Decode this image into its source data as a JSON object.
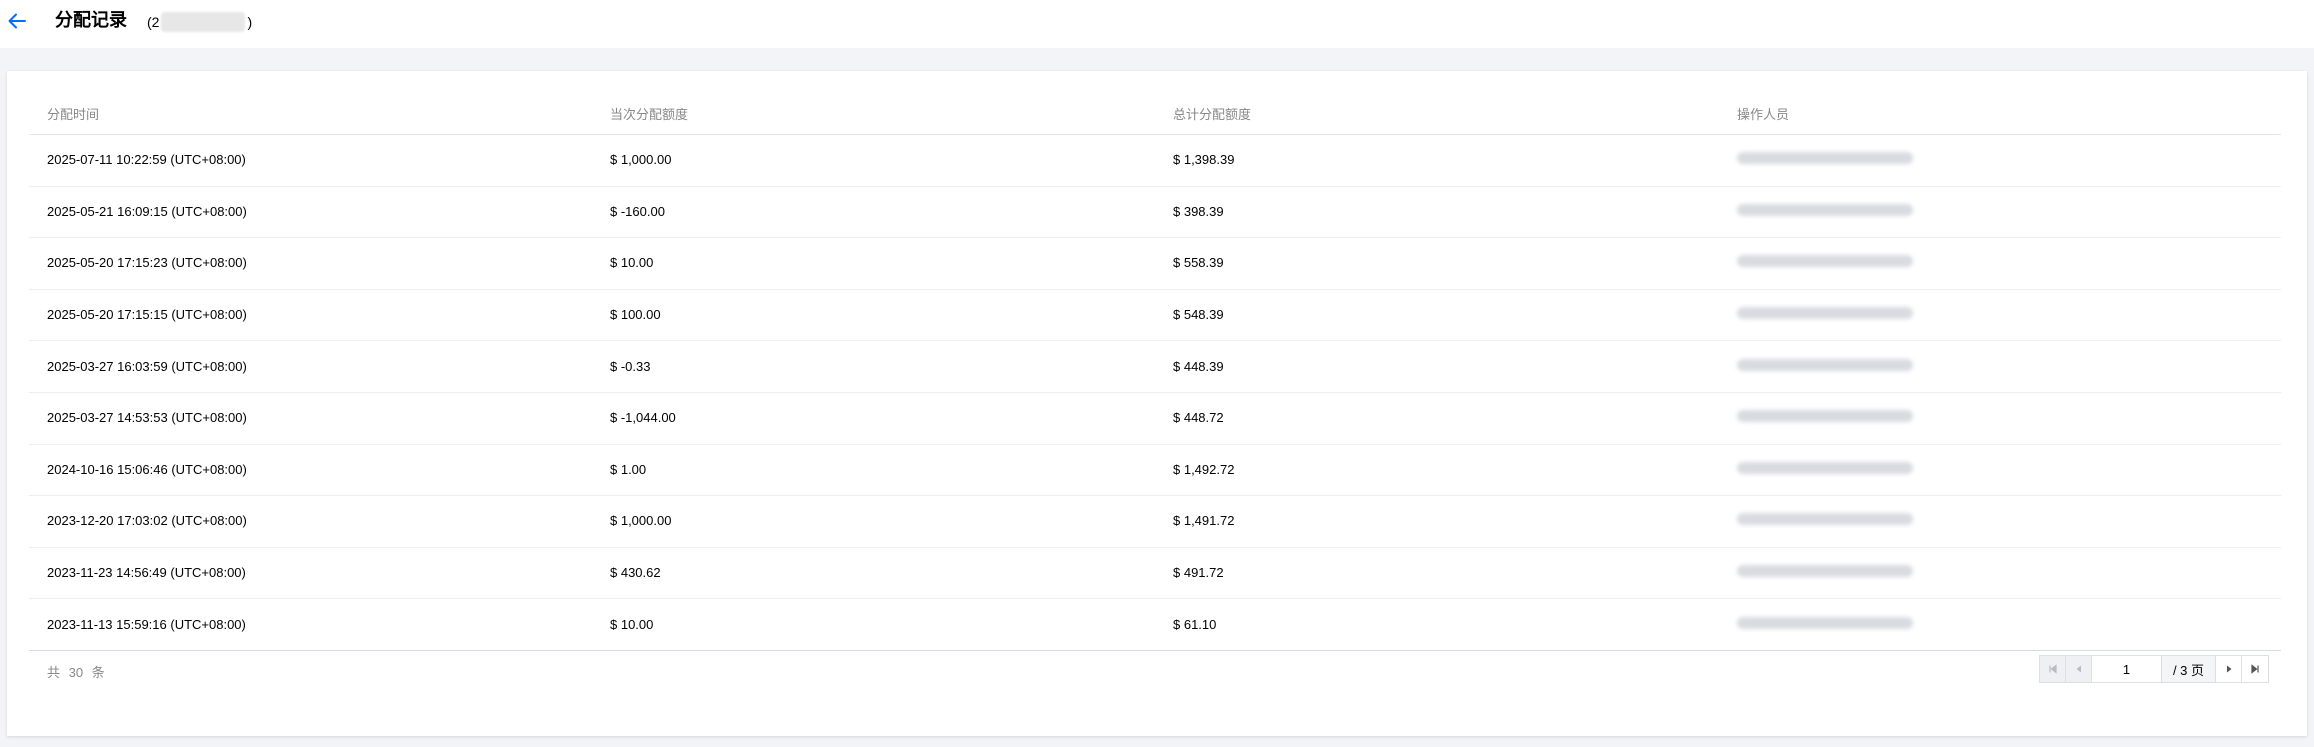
{
  "header": {
    "title": "分配记录",
    "sub_open": "(2",
    "sub_close": ")"
  },
  "table": {
    "columns": [
      "分配时间",
      "当次分配额度",
      "总计分配额度",
      "操作人员"
    ],
    "rows": [
      {
        "time": "2025-07-11 10:22:59 (UTC+08:00)",
        "amount": "$ 1,000.00",
        "total": "$ 1,398.39"
      },
      {
        "time": "2025-05-21 16:09:15 (UTC+08:00)",
        "amount": "$ -160.00",
        "total": "$ 398.39"
      },
      {
        "time": "2025-05-20 17:15:23 (UTC+08:00)",
        "amount": "$ 10.00",
        "total": "$ 558.39"
      },
      {
        "time": "2025-05-20 17:15:15 (UTC+08:00)",
        "amount": "$ 100.00",
        "total": "$ 548.39"
      },
      {
        "time": "2025-03-27 16:03:59 (UTC+08:00)",
        "amount": "$ -0.33",
        "total": "$ 448.39"
      },
      {
        "time": "2025-03-27 14:53:53 (UTC+08:00)",
        "amount": "$ -1,044.00",
        "total": "$ 448.72"
      },
      {
        "time": "2024-10-16 15:06:46 (UTC+08:00)",
        "amount": "$ 1.00",
        "total": "$ 1,492.72"
      },
      {
        "time": "2023-12-20 17:03:02 (UTC+08:00)",
        "amount": "$ 1,000.00",
        "total": "$ 1,491.72"
      },
      {
        "time": "2023-11-23 14:56:49 (UTC+08:00)",
        "amount": "$ 430.62",
        "total": "$ 491.72"
      },
      {
        "time": "2023-11-13 15:59:16 (UTC+08:00)",
        "amount": "$ 10.00",
        "total": "$ 61.10"
      }
    ]
  },
  "footer": {
    "total_text": "共 30 条"
  },
  "pager": {
    "current_page": "1",
    "total_pages_text": "/ 3 页"
  },
  "colors": {
    "accent": "#006eff",
    "muted_text": "#888888",
    "border": "#e3e6eb"
  },
  "icons": {
    "back": "arrow-left-icon",
    "first": "page-first-icon",
    "prev": "page-prev-icon",
    "next": "page-next-icon",
    "last": "page-last-icon"
  }
}
